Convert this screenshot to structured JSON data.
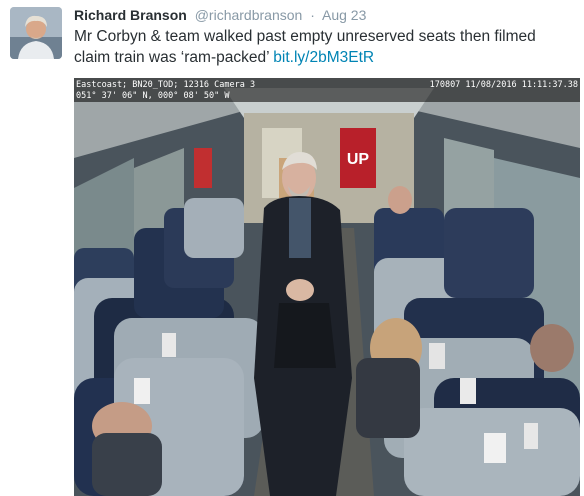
{
  "tweet": {
    "author_name": "Richard Branson",
    "handle": "@richardbranson",
    "separator": "·",
    "date": "Aug 23",
    "text": "Mr Corbyn & team walked past empty unreserved seats then filmed claim train was ‘ram-packed’",
    "link": "bit.ly/2bM3EtR"
  },
  "media": {
    "overlay_top_left": "Eastcoast; BN20_TOD; 12316 Camera 3",
    "overlay_top_right": "170807  11/08/2016 11:11:37.38",
    "overlay_coords": "051° 37' 06\" N, 000° 08' 50\" W",
    "poster_text": "UP"
  },
  "colors": {
    "link": "#0084b4",
    "name": "#292f33",
    "secondary": "#8899a6"
  },
  "icons": [
    "avatar"
  ]
}
